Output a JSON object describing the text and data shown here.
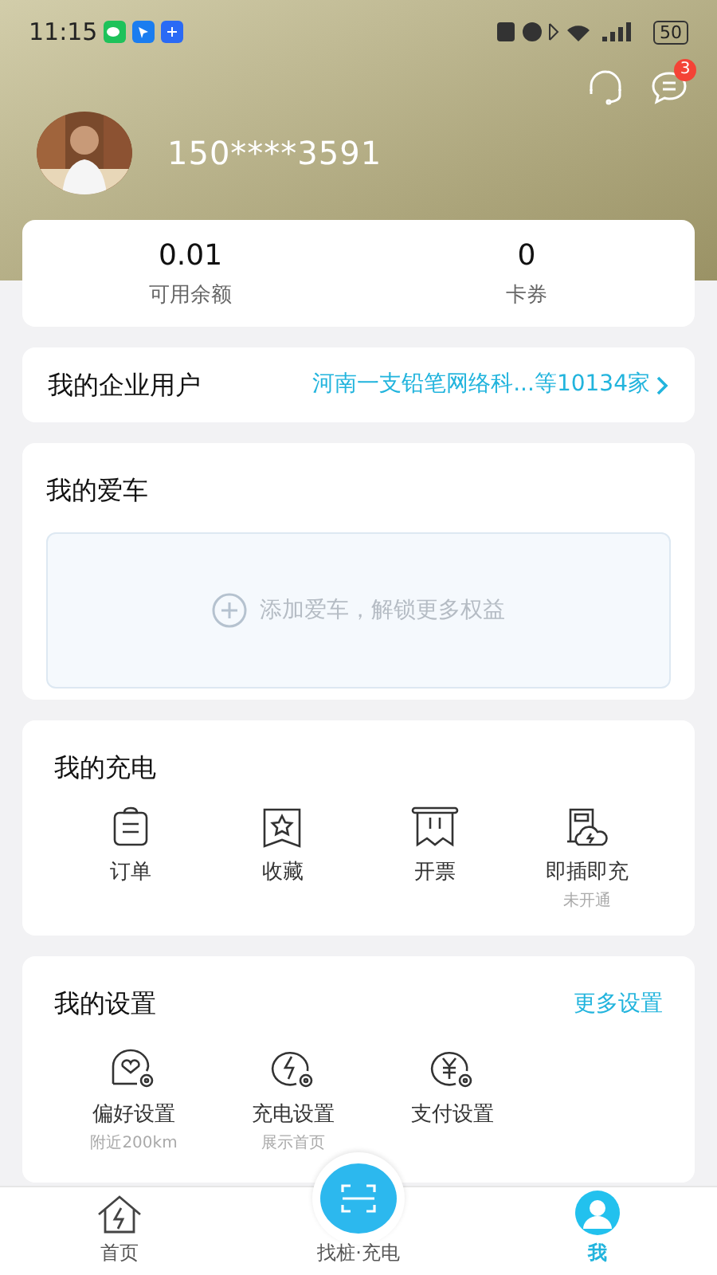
{
  "status_bar": {
    "time": "11:15",
    "battery": "50"
  },
  "header": {
    "message_badge": "3",
    "phone": "150****3591"
  },
  "stats": [
    {
      "value": "0.01",
      "label": "可用余额"
    },
    {
      "value": "0",
      "label": "卡券"
    }
  ],
  "enterprise": {
    "title": "我的企业用户",
    "value": "河南一支铅笔网络科...等10134家"
  },
  "car": {
    "title": "我的爱车",
    "add_label": "添加爱车，解锁更多权益"
  },
  "charging": {
    "title": "我的充电",
    "items": [
      {
        "kind": "order",
        "label": "订单"
      },
      {
        "kind": "favorite",
        "label": "收藏"
      },
      {
        "kind": "invoice",
        "label": "开票"
      },
      {
        "kind": "plug",
        "label": "即插即充",
        "sub": "未开通"
      }
    ]
  },
  "settings": {
    "title": "我的设置",
    "more": "更多设置",
    "items": [
      {
        "kind": "heart",
        "label": "偏好设置",
        "sub": "附近200km"
      },
      {
        "kind": "bolt",
        "label": "充电设置",
        "sub": "展示首页"
      },
      {
        "kind": "yuan",
        "label": "支付设置"
      }
    ]
  },
  "tab_bar": [
    {
      "kind": "home",
      "label": "首页",
      "selected": false
    },
    {
      "kind": "scan",
      "label": "找桩·充电",
      "selected": false
    },
    {
      "kind": "me",
      "label": "我",
      "selected": true
    }
  ]
}
